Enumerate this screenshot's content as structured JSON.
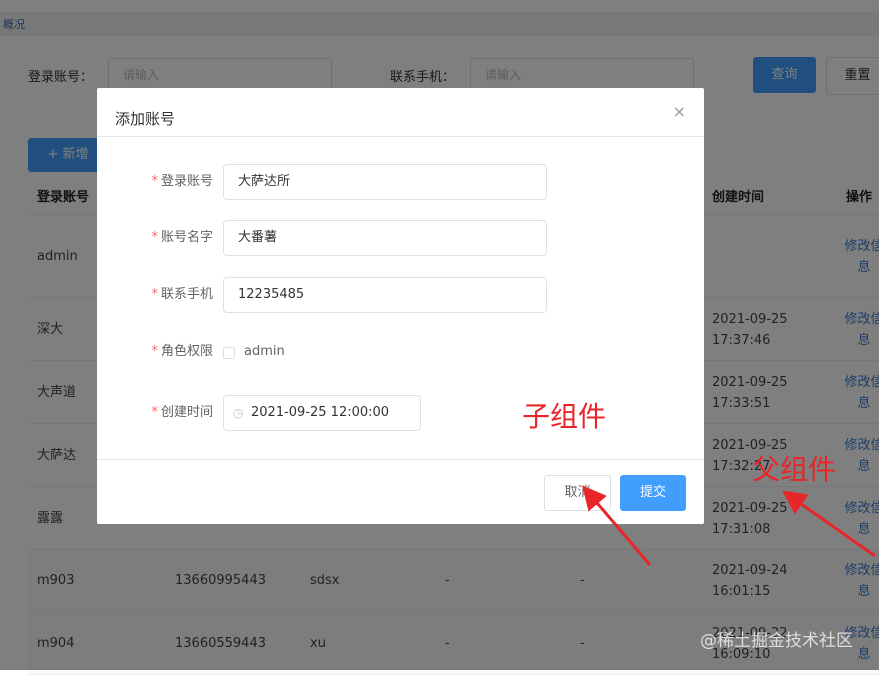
{
  "breadcrumb": "概况",
  "filters": {
    "account_label": "登录账号：",
    "account_placeholder": "请输入",
    "phone_label": "联系手机：",
    "phone_placeholder": "请输入",
    "query": "查询",
    "reset": "重置"
  },
  "add_button": "+ 新增",
  "table": {
    "headers": [
      "登录账号",
      "创建时间",
      "操作"
    ],
    "rows": [
      {
        "account": "admin",
        "phone": "",
        "name": "",
        "c4": "",
        "c5": "",
        "created": "",
        "action": "修改信息"
      },
      {
        "account": "深大",
        "phone": "",
        "name": "",
        "c4": "",
        "c5": "",
        "created": "2021-09-25 17:37:46",
        "action": "修改信息"
      },
      {
        "account": "大声道",
        "phone": "",
        "name": "",
        "c4": "",
        "c5": "",
        "created": "2021-09-25 17:33:51",
        "action": "修改信息"
      },
      {
        "account": "大萨达",
        "phone": "",
        "name": "",
        "c4": "",
        "c5": "",
        "created": "2021-09-25 17:32:27",
        "action": "修改信息"
      },
      {
        "account": "露露",
        "phone": "",
        "name": "",
        "c4": "",
        "c5": "",
        "created": "2021-09-25 17:31:08",
        "action": "修改信息"
      },
      {
        "account": "m903",
        "phone": "13660995443",
        "name": "sdsx",
        "c4": "-",
        "c5": "-",
        "created": "2021-09-24 16:01:15",
        "action": "修改信息"
      },
      {
        "account": "m904",
        "phone": "13660559443",
        "name": "xu",
        "c4": "-",
        "c5": "-",
        "created": "2021-09-22 16:09:10",
        "action": "修改信息"
      }
    ]
  },
  "dialog": {
    "title": "添加账号",
    "close": "×",
    "fields": [
      {
        "label": "登录账号",
        "value": "大萨达所"
      },
      {
        "label": "账号名字",
        "value": "大番薯"
      },
      {
        "label": "联系手机",
        "value": "12235485"
      },
      {
        "label": "角色权限",
        "value": "admin"
      },
      {
        "label": "创建时间",
        "value": "2021-09-25 12:00:00"
      }
    ],
    "cancel": "取消",
    "submit": "提交"
  },
  "annotations": {
    "child": "子组件",
    "parent": "父组件"
  },
  "watermark": "@稀土掘金技术社区",
  "colors": {
    "primary": "#409eff",
    "annotation": "#e8262a"
  }
}
